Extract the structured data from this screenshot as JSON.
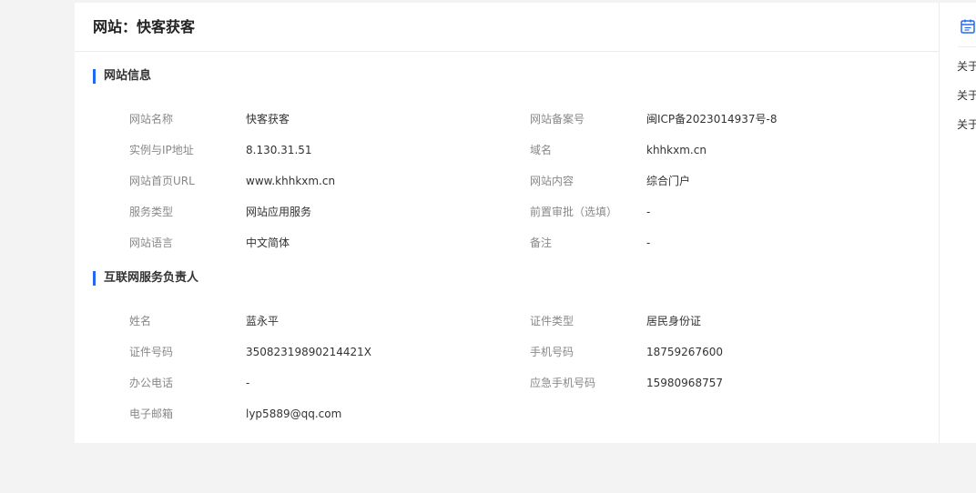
{
  "header": {
    "title": "网站：快客获客"
  },
  "sections": {
    "website_info": {
      "title": "网站信息",
      "left": [
        {
          "label": "网站名称",
          "value": "快客获客"
        },
        {
          "label": "实例与IP地址",
          "value": "8.130.31.51"
        },
        {
          "label": "网站首页URL",
          "value": "www.khhkxm.cn"
        },
        {
          "label": "服务类型",
          "value": "网站应用服务"
        },
        {
          "label": "网站语言",
          "value": "中文简体"
        }
      ],
      "right": [
        {
          "label": "网站备案号",
          "value": "闽ICP备2023014937号-8"
        },
        {
          "label": "域名",
          "value": "khhkxm.cn"
        },
        {
          "label": "网站内容",
          "value": "综合门户"
        },
        {
          "label": "前置审批（选填）",
          "value": "-"
        },
        {
          "label": "备注",
          "value": "-"
        }
      ]
    },
    "responsible_person": {
      "title": "互联网服务负责人",
      "left": [
        {
          "label": "姓名",
          "value": "蓝永平"
        },
        {
          "label": "证件号码",
          "value": "35082319890214421X"
        },
        {
          "label": "办公电话",
          "value": "-"
        },
        {
          "label": "电子邮箱",
          "value": "lyp5889@qq.com"
        }
      ],
      "right": [
        {
          "label": "证件类型",
          "value": "居民身份证"
        },
        {
          "label": "手机号码",
          "value": "18759267600"
        },
        {
          "label": "应急手机号码",
          "value": "15980968757"
        }
      ]
    }
  },
  "side_panel": {
    "icon": "calendar-icon",
    "links": [
      "关于",
      "关于",
      "关于"
    ]
  },
  "colors": {
    "accent": "#2468f2",
    "background": "#f3f3f3",
    "label": "#888888",
    "value": "#333333"
  }
}
